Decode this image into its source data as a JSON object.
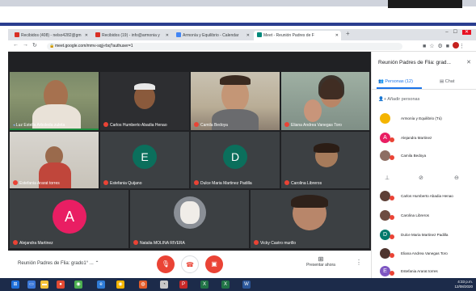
{
  "colors": {
    "meet_bg": "#202124",
    "tile_bg": "#3c4043",
    "mic_off": "#ea4335",
    "accent": "#1a73e8",
    "speaking": "#1e8e3e",
    "end_call": "#ea4335",
    "taskbar": "#1c2b4a"
  },
  "browser": {
    "tabs": [
      {
        "label": "Recibidos (408) - nelso4282@gm",
        "icon": "gmail-icon"
      },
      {
        "label": "Recibidos (19) - info@armonia y",
        "icon": "gmail-icon"
      },
      {
        "label": "Armonía y Equilibrio - Calendar",
        "icon": "calendar-icon"
      },
      {
        "label": "Meet - Reunión Padres de F",
        "icon": "meet-icon"
      }
    ],
    "new_tab": "+",
    "url": "meet.google.com/mmv-sqjj-rbq?authuser=1"
  },
  "tiles": [
    {
      "name": "Luz Estella Arboleda zuleta",
      "kind": "video"
    },
    {
      "name": "Carlos Humberto Abadia Henao",
      "kind": "video"
    },
    {
      "name": "Camila Bedoya",
      "kind": "video"
    },
    {
      "name": "Eliana Andrea Vanegas Toro",
      "kind": "video"
    },
    {
      "name": "Estefania Ararat torres",
      "kind": "video"
    },
    {
      "name": "Estefania Quijano",
      "kind": "avatar",
      "initial": "E"
    },
    {
      "name": "Dulce Maria Martinez Padilla",
      "kind": "avatar",
      "initial": "D"
    },
    {
      "name": "Carolina Libreros",
      "kind": "video"
    },
    {
      "name": "Alejandra Martinez",
      "kind": "avatar",
      "initial": "A"
    },
    {
      "name": "Natalia MOLINA RIVERA",
      "kind": "video"
    },
    {
      "name": "Vicky Castro murillo",
      "kind": "video"
    }
  ],
  "bottom": {
    "meeting_title": "Reunión Padres de Flia: grado1° ...",
    "present_label": "Presentar ahora"
  },
  "panel": {
    "title": "Reunión Padres de Flia: grad...",
    "tab_people": "Personas (12)",
    "tab_chat": "Chat",
    "add_people": "Añadir personas",
    "people": [
      {
        "name": "Armonía y Equilibrio (Tú)",
        "initial": "",
        "color": "#f4b400"
      },
      {
        "name": "Alejandra Martinez",
        "initial": "A",
        "color": "#e91e63"
      },
      {
        "name": "Camila Bedoya",
        "initial": "",
        "color": "#8d6e63"
      },
      {
        "name": "Carlos Humberto Abadia Henao",
        "initial": "",
        "color": "#5d4037"
      },
      {
        "name": "Carolina Libreros",
        "initial": "",
        "color": "#6d4c41"
      },
      {
        "name": "Dulce Maria Martinez Padilla",
        "initial": "D",
        "color": "#00796b"
      },
      {
        "name": "Eliana Andrea Vanegas Toro",
        "initial": "",
        "color": "#4e342e"
      },
      {
        "name": "Estefania Ararat torres",
        "initial": "E",
        "color": "#7e57c2"
      }
    ]
  },
  "taskbar": {
    "time": "4:33 p.m.",
    "date": "12/08/2020"
  }
}
